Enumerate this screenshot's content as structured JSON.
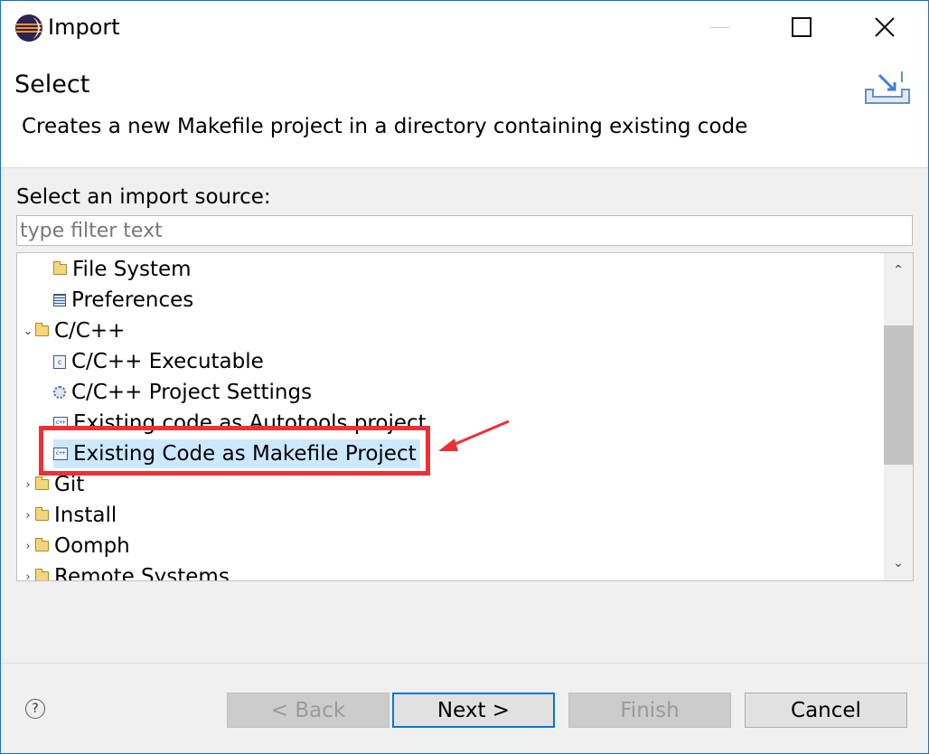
{
  "window": {
    "title": "Import",
    "icon": "eclipse-icon"
  },
  "header": {
    "title": "Select",
    "description": "Creates a new Makefile project in a directory containing existing code",
    "icon": "import-wizard-icon"
  },
  "main": {
    "source_label": "Select an import source:",
    "filter_placeholder": "type filter text",
    "filter_value": "",
    "tree": {
      "items": [
        {
          "label": "File System",
          "icon": "folder-icon",
          "level": 1
        },
        {
          "label": "Preferences",
          "icon": "preferences-icon",
          "level": 1
        },
        {
          "label": "C/C++",
          "icon": "folder-icon",
          "level": 0,
          "expanded": true
        },
        {
          "label": "C/C++ Executable",
          "icon": "c-executable-icon",
          "level": 1
        },
        {
          "label": "C/C++ Project Settings",
          "icon": "project-settings-icon",
          "level": 1
        },
        {
          "label": "Existing code as Autotools project",
          "icon": "cpp-project-icon",
          "level": 1
        },
        {
          "label": "Existing Code as Makefile Project",
          "icon": "cpp-project-icon",
          "level": 1,
          "selected": true
        },
        {
          "label": "Git",
          "icon": "folder-icon",
          "level": 0,
          "expanded": false
        },
        {
          "label": "Install",
          "icon": "folder-icon",
          "level": 0,
          "expanded": false
        },
        {
          "label": "Oomph",
          "icon": "folder-icon",
          "level": 0,
          "expanded": false
        },
        {
          "label": "Remote Systems",
          "icon": "folder-icon",
          "level": 0,
          "expanded": false
        }
      ]
    }
  },
  "buttons": {
    "back": "< Back",
    "next": "Next >",
    "finish": "Finish",
    "cancel": "Cancel"
  },
  "annotation": {
    "color": "#ee3035"
  },
  "colors": {
    "selection": "#cce8ff",
    "accent": "#0078d7"
  }
}
